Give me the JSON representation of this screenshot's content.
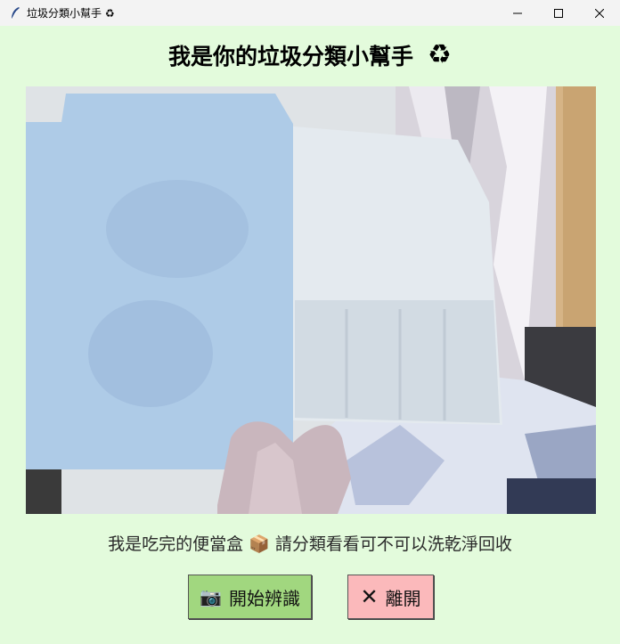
{
  "window": {
    "title": "垃圾分類小幫手 ♻"
  },
  "header": {
    "title": "我是你的垃圾分類小幫手",
    "title_icon": "♻"
  },
  "camera": {
    "icon": "camera-feed"
  },
  "result": {
    "caption": "我是吃完的便當盒 📦 請分類看看可不可以洗乾淨回收"
  },
  "buttons": {
    "start_icon": "📷",
    "start_label": "開始辨識",
    "exit_icon": "✕",
    "exit_label": "離開"
  },
  "colors": {
    "background": "#e3fbdc",
    "start_button": "#a1d77f",
    "exit_button": "#fbb9bb"
  }
}
